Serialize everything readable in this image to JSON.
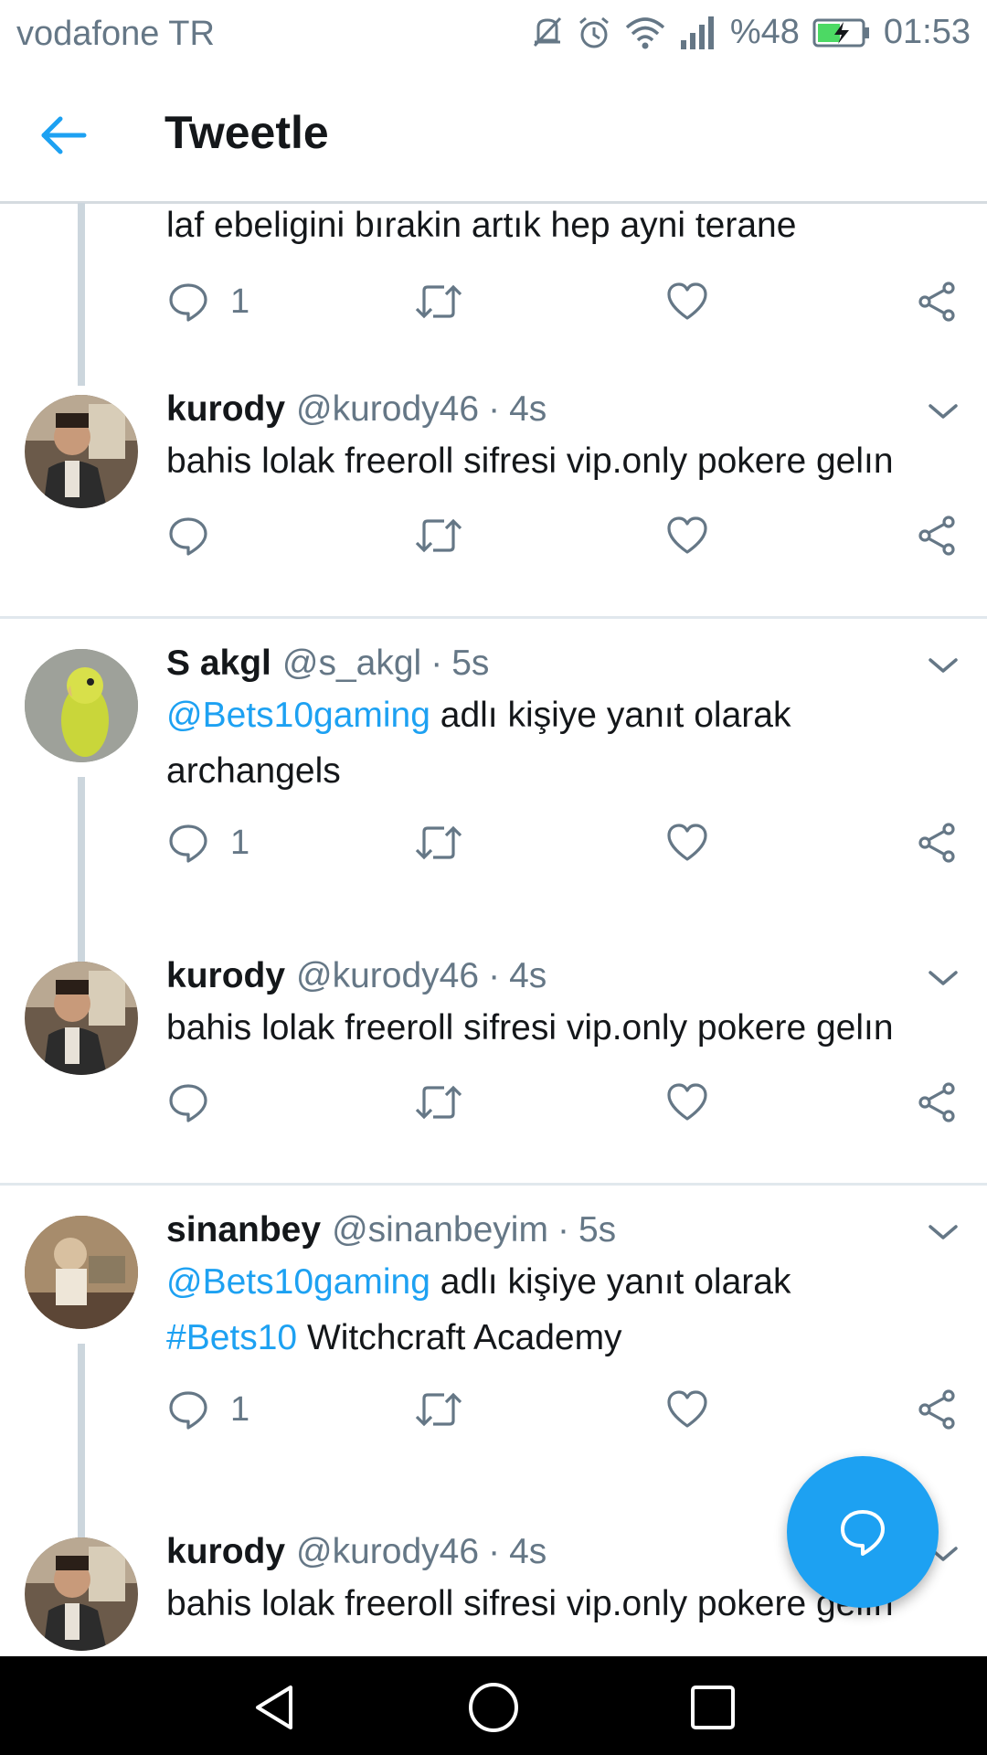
{
  "status_bar": {
    "carrier": "vodafone TR",
    "battery_percent": "%48",
    "time": "01:53"
  },
  "app_bar": {
    "title": "Tweetle",
    "back_icon": "arrow-left-icon"
  },
  "colors": {
    "accent": "#1da1f2",
    "text_primary": "#14171a",
    "text_secondary": "#657786",
    "thread_line": "#ccd6dd"
  },
  "tweets": [
    {
      "text": "laf ebeligini bırakin artık hep ayni terane",
      "reply_count": "1"
    },
    {
      "name": "kurody",
      "handle": "@kurody46",
      "time": "4s",
      "text": "bahis lolak freeroll sifresi vip.only pokere gelın",
      "reply_count": ""
    },
    {
      "name": "S akgl",
      "handle": "@s_akgl",
      "time": "5s",
      "reply_to_mention": "@Bets10gaming",
      "reply_to_suffix": "adlı kişiye yanıt olarak",
      "text": "archangels",
      "reply_count": "1"
    },
    {
      "name": "kurody",
      "handle": "@kurody46",
      "time": "4s",
      "text": "bahis lolak freeroll sifresi vip.only pokere gelın",
      "reply_count": ""
    },
    {
      "name": "sinanbey",
      "handle": "@sinanbeyim",
      "time": "5s",
      "reply_to_mention": "@Bets10gaming",
      "reply_to_suffix": "adlı kişiye yanıt olarak",
      "hashtag": "#Bets10",
      "text": "Witchcraft Academy",
      "reply_count": "1"
    },
    {
      "name": "kurody",
      "handle": "@kurody46",
      "time": "4s",
      "text": "bahis lolak freeroll sifresi vip.only pokere gelın"
    }
  ],
  "separator": "·",
  "fab_icon": "compose-reply-icon",
  "nav_icons": [
    "back-triangle-icon",
    "home-circle-icon",
    "recents-square-icon"
  ]
}
